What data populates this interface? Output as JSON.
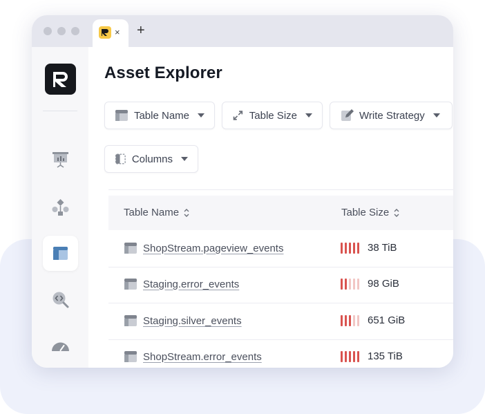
{
  "tab": {
    "close_label": "×",
    "new_tab_label": "+"
  },
  "colors": {
    "accent_yellow": "#f7c948",
    "bar_full": "#d9534f",
    "bar_empty": "#f2c6c4",
    "active_nav": "#4a7fb5"
  },
  "sidebar": {
    "items": [
      {
        "name": "presentation-chart-icon"
      },
      {
        "name": "workflow-icon"
      },
      {
        "name": "table-layout-icon",
        "active": true
      },
      {
        "name": "code-search-icon"
      },
      {
        "name": "gauge-icon"
      }
    ]
  },
  "page": {
    "title": "Asset Explorer"
  },
  "filters": [
    {
      "label": "Table Name",
      "icon": "table-icon"
    },
    {
      "label": "Table Size",
      "icon": "expand-arrows-icon"
    },
    {
      "label": "Write Strategy",
      "icon": "edit-icon"
    },
    {
      "label": "Columns",
      "icon": "columns-icon"
    }
  ],
  "table": {
    "headers": [
      "Table Name",
      "Table Size"
    ],
    "rows": [
      {
        "name": "ShopStream.pageview_events",
        "size": "38 TiB",
        "level": 5
      },
      {
        "name": "Staging.error_events",
        "size": "98 GiB",
        "level": 2
      },
      {
        "name": "Staging.silver_events",
        "size": "651 GiB",
        "level": 3
      },
      {
        "name": "ShopStream.error_events",
        "size": "135 TiB",
        "level": 5
      }
    ]
  }
}
